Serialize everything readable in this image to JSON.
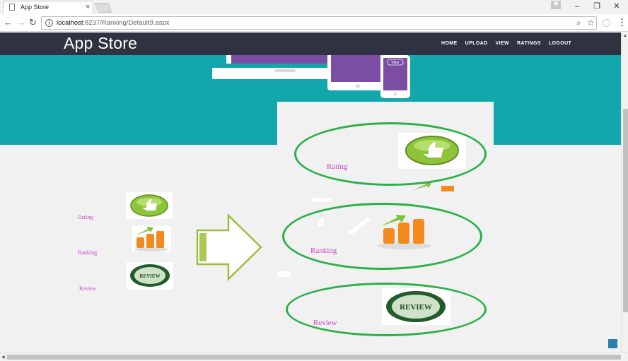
{
  "browser": {
    "tab_title": "App Store",
    "url_host": "localhost",
    "url_path": ":8237/Ranking/Default9.aspx"
  },
  "site": {
    "brand": "App Store",
    "nav": [
      "HOME",
      "UPLOAD",
      "VIEW",
      "RATINGS",
      "LOGOUT"
    ]
  },
  "hero": {
    "phone_badge": "Viber"
  },
  "left_list": {
    "items": [
      {
        "label": "Rating",
        "icon": "thumbs-up-icon"
      },
      {
        "label": "Ranking",
        "icon": "bar-chart-growth-icon"
      },
      {
        "label": "Review",
        "icon": "review-stamp-icon"
      }
    ]
  },
  "right_list": {
    "items": [
      {
        "label": "Rating",
        "icon": "thumbs-up-icon"
      },
      {
        "label": "Ranking",
        "icon": "bar-chart-growth-icon"
      },
      {
        "label": "Review",
        "icon": "review-stamp-icon"
      }
    ]
  },
  "stamp_text": "REVIEW",
  "colors": {
    "navbar": "#2f3240",
    "hero": "#13a6aa",
    "label": "#cc44cc",
    "ring": "#2bb04a",
    "arrow": "#9cc03c"
  }
}
